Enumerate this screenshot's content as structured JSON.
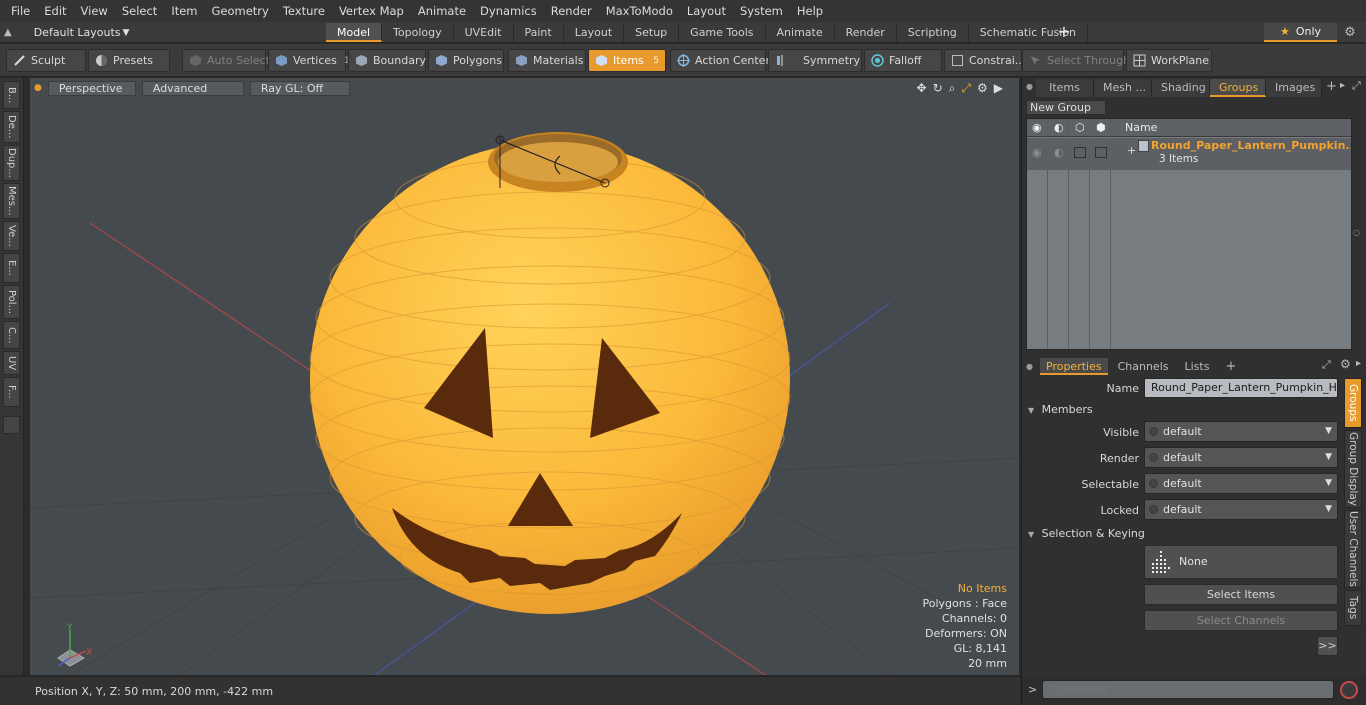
{
  "menu": [
    "File",
    "Edit",
    "View",
    "Select",
    "Item",
    "Geometry",
    "Texture",
    "Vertex Map",
    "Animate",
    "Dynamics",
    "Render",
    "MaxToModo",
    "Layout",
    "System",
    "Help"
  ],
  "layouts_label": "Default Layouts",
  "tabs": [
    "Model",
    "Topology",
    "UVEdit",
    "Paint",
    "Layout",
    "Setup",
    "Game Tools",
    "Animate",
    "Render",
    "Scripting",
    "Schematic Fusion"
  ],
  "only_label": "Only",
  "toolbar": {
    "sculpt": "Sculpt",
    "presets": "Presets",
    "auto_select": "Auto Select",
    "vertices": "Vertices",
    "vertices_count": "1",
    "boundary": "Boundary",
    "polygons": "Polygons",
    "materials": "Materials",
    "items": "Items",
    "items_count": "5",
    "action_center": "Action Center",
    "symmetry": "Symmetry",
    "falloff": "Falloff",
    "constraints": "Constrai...",
    "select_through": "Select Through",
    "workplane": "WorkPlane"
  },
  "left_tabs": [
    "B...",
    "De...",
    "Dup...",
    "Mes...",
    "Ve...",
    "E...",
    "Pol...",
    "C...",
    "UV",
    "F..."
  ],
  "viewport": {
    "perspective": "Perspective",
    "advanced": "Advanced",
    "raygl": "Ray GL: Off",
    "stats": {
      "no_items": "No Items",
      "polygons": "Polygons : Face",
      "channels": "Channels: 0",
      "deformers": "Deformers: ON",
      "gl": "GL: 8,141",
      "size": "20 mm"
    }
  },
  "status": {
    "position": "Position X, Y, Z:  50 mm, 200 mm, -422 mm"
  },
  "right_tabs": [
    "Items",
    "Mesh ...",
    "Shading",
    "Groups",
    "Images"
  ],
  "groups": {
    "new_group": "New Group",
    "name_header": "Name",
    "group_name": "Round_Paper_Lantern_Pumpkin...",
    "group_items": "3 Items"
  },
  "prop_tabs": [
    "Properties",
    "Channels",
    "Lists"
  ],
  "properties": {
    "name_label": "Name",
    "name_value": "Round_Paper_Lantern_Pumpkin_Head",
    "members": "Members",
    "visible_label": "Visible",
    "render_label": "Render",
    "selectable_label": "Selectable",
    "locked_label": "Locked",
    "default_value": "default",
    "selection_keying": "Selection & Keying",
    "none_label": "None",
    "select_items": "Select Items",
    "select_channels": "Select Channels",
    "more": ">>"
  },
  "side_tabs": [
    "Groups",
    "Group Display",
    "User Channels",
    "Tags"
  ],
  "command_placeholder": "Command"
}
